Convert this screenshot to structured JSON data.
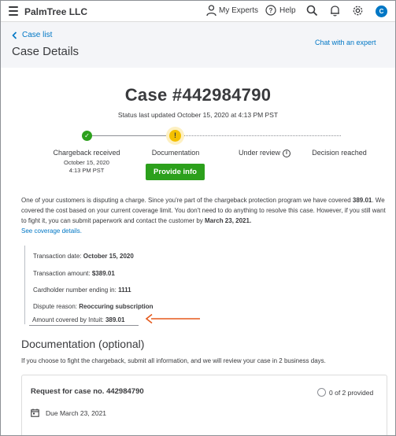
{
  "topbar": {
    "company": "PalmTree LLC",
    "my_experts": "My Experts",
    "help": "Help",
    "avatar_initial": "C"
  },
  "header": {
    "back_link": "Case list",
    "page_title": "Case Details",
    "chat_link": "Chat with an expert"
  },
  "case": {
    "title": "Case #442984790",
    "status_updated": "Status last updated October 15, 2020 at 4:13 PM PST"
  },
  "steps": [
    {
      "label": "Chargeback received",
      "date": "October 15, 2020",
      "time": "4:13 PM PST",
      "state": "done"
    },
    {
      "label": "Documentation",
      "state": "current"
    },
    {
      "label": "Under review",
      "state": "pending"
    },
    {
      "label": "Decision reached",
      "state": "pending"
    }
  ],
  "provide_info_button": "Provide info",
  "description": {
    "part1": "One of your customers is disputing a charge. Since you're part of the chargeback protection program we have covered ",
    "amount": "389.01",
    "part2": ". We covered the cost based on your current coverage limit. You don't need to do anything to resolve this case. However, if you still want to fight it, you can submit paperwork and contact the customer by ",
    "deadline": "March 23, 2021.",
    "link": "See coverage details."
  },
  "details": [
    {
      "label": "Transaction date: ",
      "value": "October 15, 2020"
    },
    {
      "label": "Transaction amount: ",
      "value": "$389.01"
    },
    {
      "label": "Cardholder number ending in: ",
      "value": "1111"
    },
    {
      "label": "Dispute reason: ",
      "value": "Reoccuring subscription"
    },
    {
      "label": "Amount covered by Intuit: ",
      "value": "389.01"
    }
  ],
  "documentation": {
    "title": "Documentation (optional)",
    "subtitle": "If you choose to fight the chargeback, submit all information, and we will review your case in 2 business days.",
    "request_title": "Request for case no. 442984790",
    "provided": "0 of 2 provided",
    "due": "Due March 23, 2021"
  },
  "colors": {
    "brand_green": "#2ca01c",
    "link_blue": "#0077c5",
    "warning_yellow": "#f4c000",
    "arrow_orange": "#e5591c",
    "header_grey": "#f4f5f8"
  },
  "icons": [
    "hamburger-icon",
    "person-icon",
    "help-icon",
    "search-icon",
    "bell-icon",
    "gear-icon",
    "chevron-left-icon",
    "check-icon",
    "exclamation-icon",
    "info-icon",
    "calendar-icon",
    "circle-icon",
    "arrow-left-icon"
  ]
}
